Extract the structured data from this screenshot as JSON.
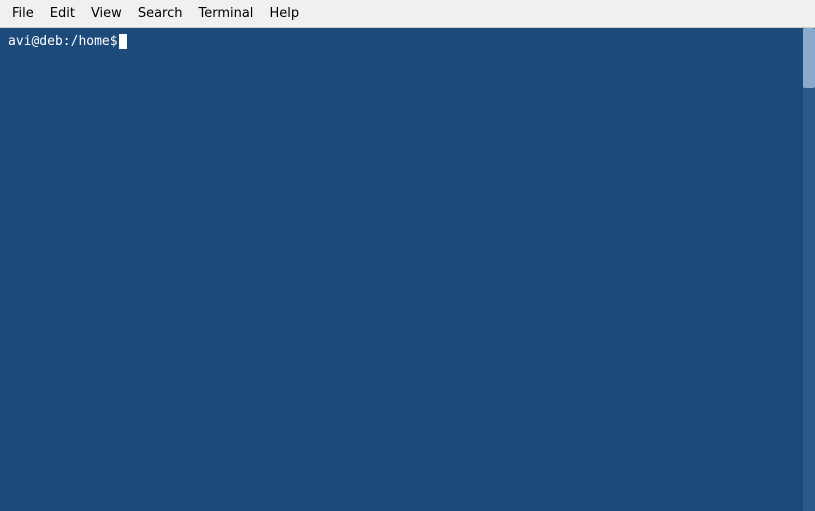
{
  "menubar": {
    "items": [
      {
        "id": "file",
        "label": "File"
      },
      {
        "id": "edit",
        "label": "Edit"
      },
      {
        "id": "view",
        "label": "View"
      },
      {
        "id": "search",
        "label": "Search"
      },
      {
        "id": "terminal",
        "label": "Terminal"
      },
      {
        "id": "help",
        "label": "Help"
      }
    ]
  },
  "terminal": {
    "prompt": "avi@deb:/home$",
    "background_color": "#1c4a7a"
  }
}
